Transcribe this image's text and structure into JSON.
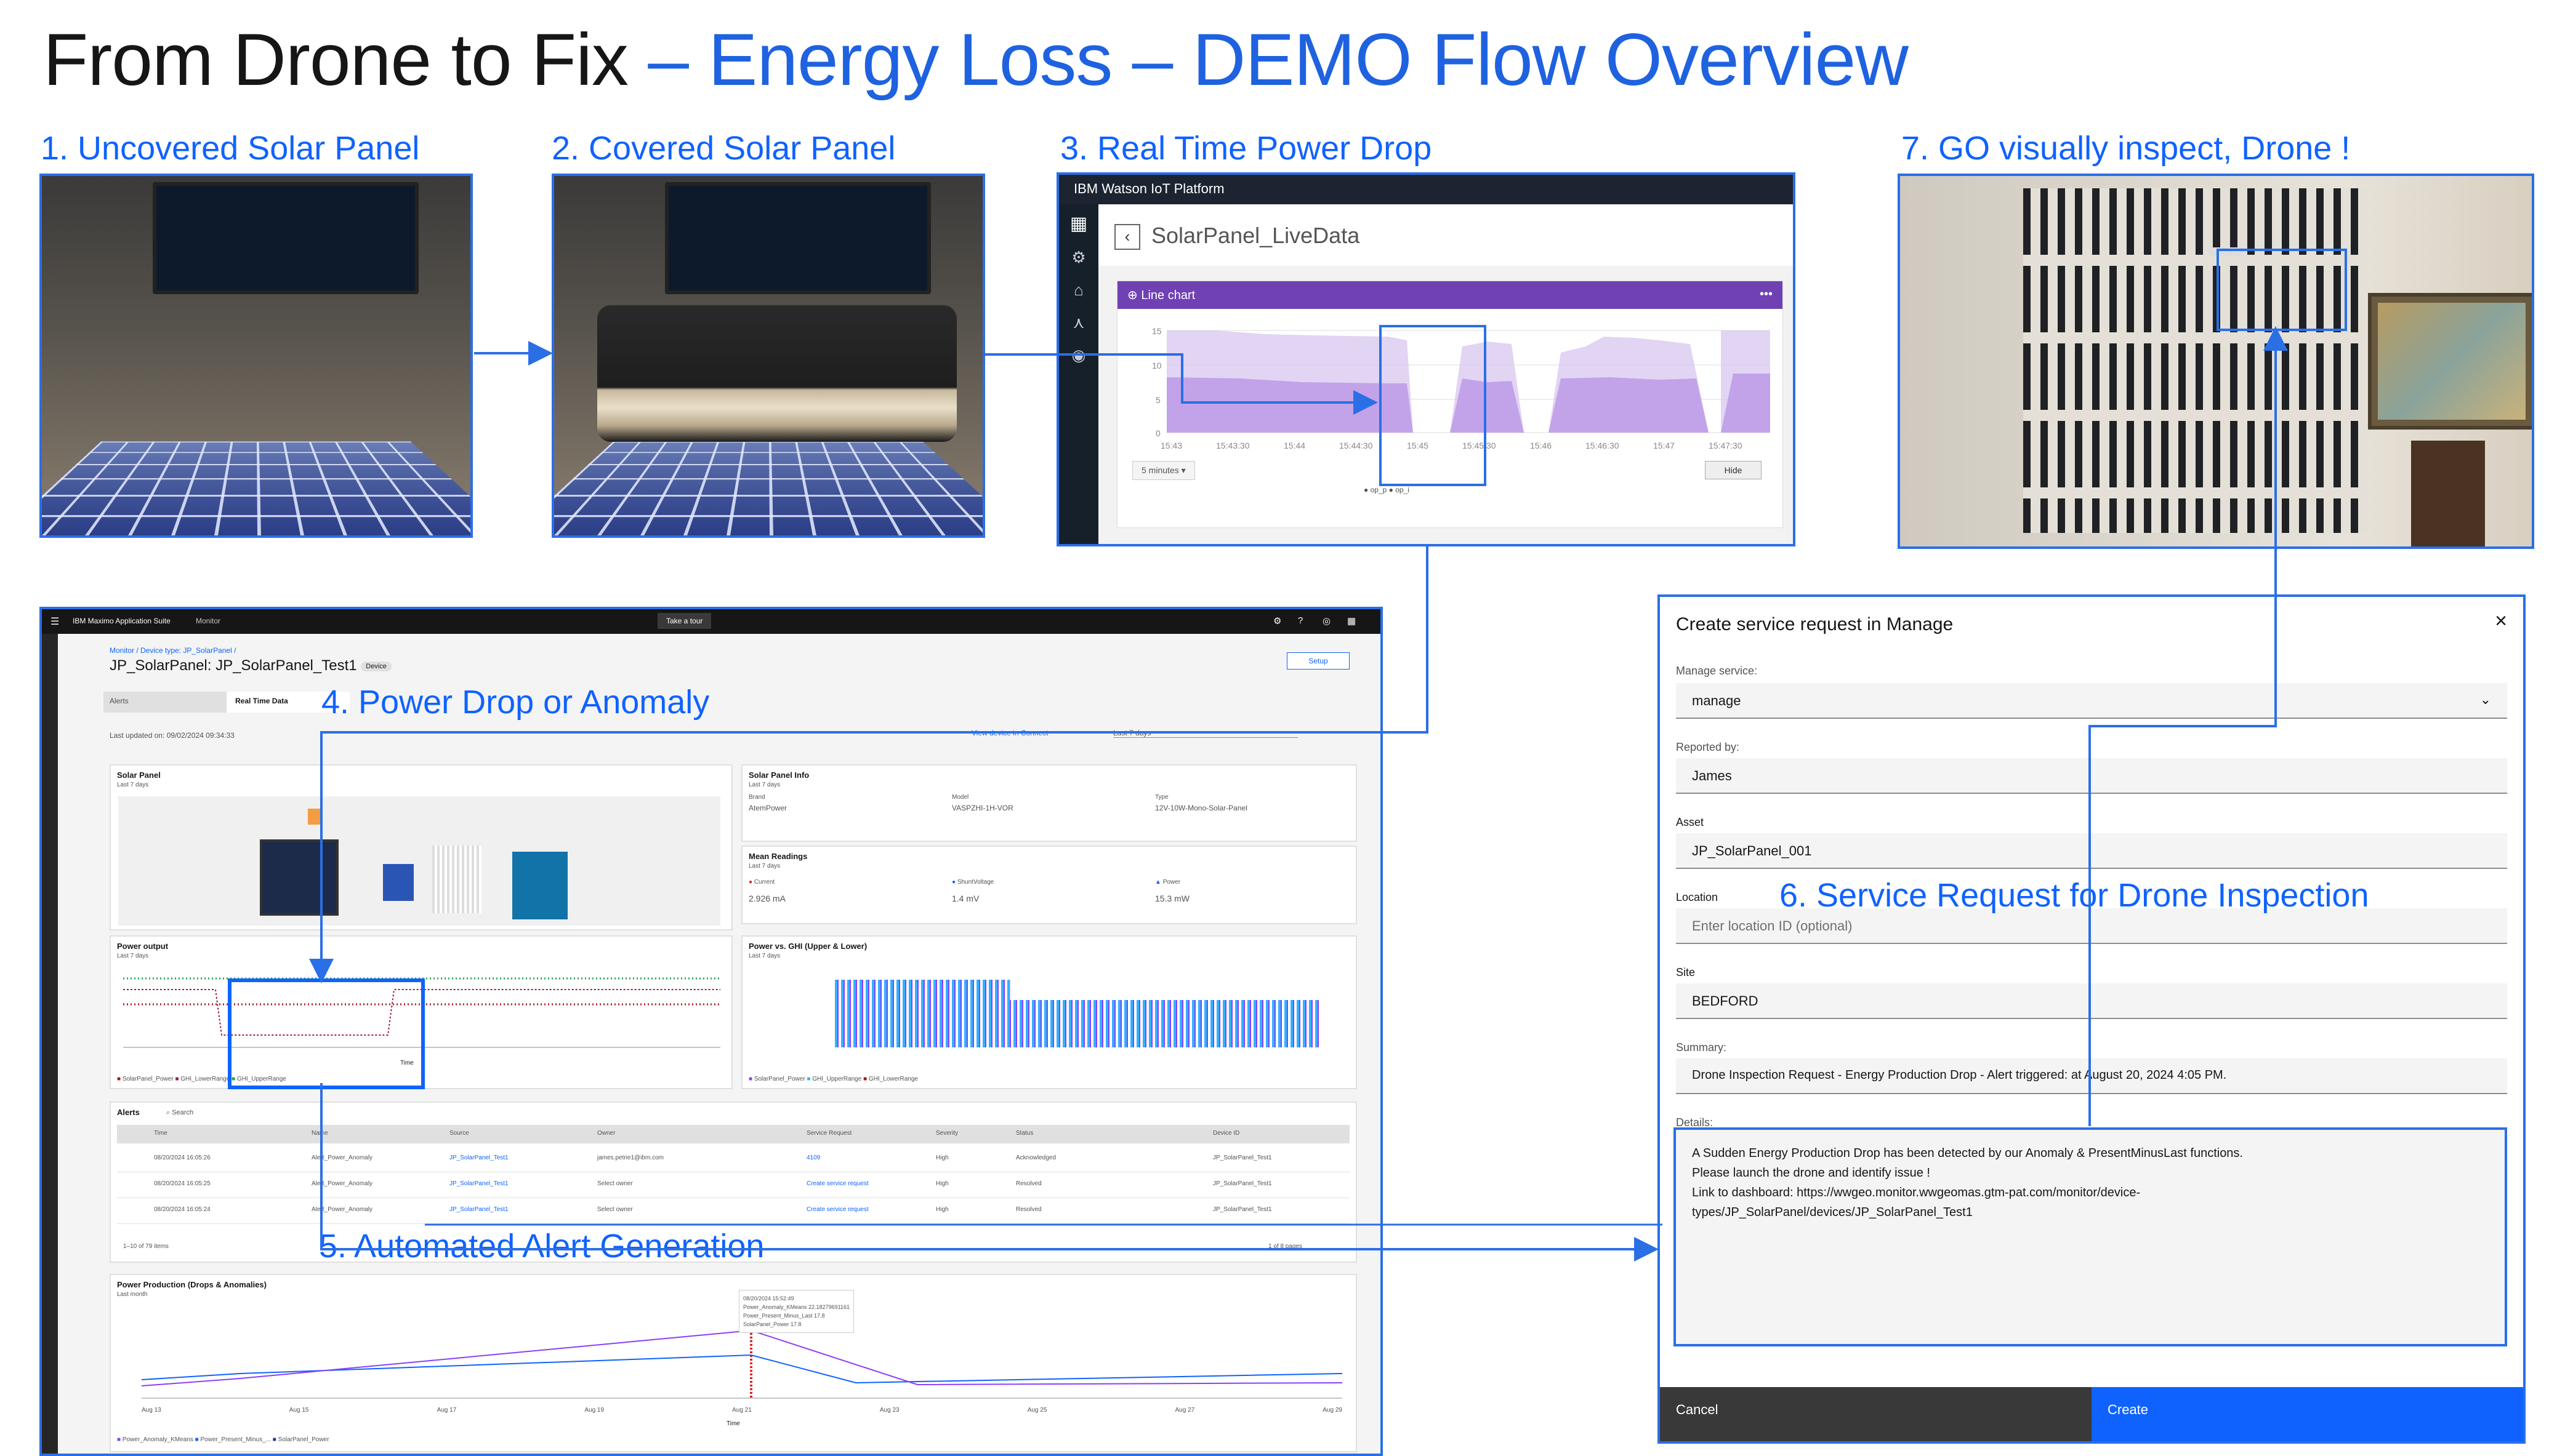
{
  "title": {
    "part1": "From Drone to Fix",
    "part2": "– Energy Loss – DEMO Flow Overview"
  },
  "steps": {
    "s1": "1. Uncovered Solar Panel",
    "s2": "2. Covered Solar Panel",
    "s3": "3. Real Time Power Drop",
    "s4": "4. Power Drop or Anomaly",
    "s5": "5. Automated Alert Generation",
    "s6": "6. Service Request for Drone Inspection",
    "s7": "7. GO visually inspect, Drone !"
  },
  "watson": {
    "platform": "IBM Watson IoT Platform",
    "page_title": "SolarPanel_LiveData",
    "chart_title": "Line chart",
    "menu": "•••",
    "range": "5 minutes",
    "button": "Hide",
    "x_ticks": [
      "15:43",
      "15:43:30",
      "15:44",
      "15:44:30",
      "15:45",
      "15:45:30",
      "15:46",
      "15:46:30",
      "15:47",
      "15:47:30"
    ],
    "y_ticks": [
      "15",
      "10",
      "5",
      "0"
    ],
    "legend": [
      "op_p",
      "op_i"
    ]
  },
  "maximo": {
    "suite": "IBM Maximo Application Suite",
    "app": "Monitor",
    "tour": "Take a tour",
    "breadcrumb": "Monitor  /  Device type: JP_SolarPanel  /",
    "device_title": "JP_SolarPanel: JP_SolarPanel_Test1",
    "device_tag": "Device",
    "setup": "Setup",
    "tabs": [
      "Alerts",
      "Real Time Data"
    ],
    "last_updated": "Last updated on:  09/02/2024 09:34:33",
    "view_device": "View device in Connect",
    "time_range": "Last 7 days",
    "solar_panel_card": {
      "title": "Solar Panel",
      "sub": "Last 7 days"
    },
    "info_card": {
      "title": "Solar Panel Info",
      "sub": "Last 7 days",
      "cols": [
        {
          "label": "Brand",
          "value": "AtemPower"
        },
        {
          "label": "Model",
          "value": "VASPZHI-1H-VOR"
        },
        {
          "label": "Type",
          "value": "12V-10W-Mono-Solar-Panel"
        }
      ]
    },
    "readings_card": {
      "title": "Mean Readings",
      "sub": "Last 7 days",
      "cols": [
        {
          "label": "Current",
          "value": "2.926 mA"
        },
        {
          "label": "ShuntVoltage",
          "value": "1.4 mV"
        },
        {
          "label": "Power",
          "value": "15.3 mW"
        }
      ]
    },
    "power_output": {
      "title": "Power output",
      "sub": "Last 7 days",
      "legend": [
        "SolarPanel_Power",
        "GHI_LowerRange",
        "GHI_UpperRange"
      ],
      "xlabel": "Time"
    },
    "power_ghi": {
      "title": "Power vs. GHI (Upper & Lower)",
      "sub": "Last 7 days",
      "legend": [
        "SolarPanel_Power",
        "GHI_UpperRange",
        "GHI_LowerRange"
      ]
    },
    "alerts": {
      "title": "Alerts",
      "search": "Search",
      "headers": [
        "Time",
        "Name",
        "Source",
        "Owner",
        "Service Request",
        "Severity",
        "Status",
        "Device ID"
      ],
      "rows": [
        [
          "08/20/2024 16:05:26",
          "Alert_Power_Anomaly",
          "JP_SolarPanel_Test1",
          "james.petrie1@ibm.com",
          "4109",
          "High",
          "Acknowledged",
          "JP_SolarPanel_Test1"
        ],
        [
          "08/20/2024 16:05:25",
          "Alert_Power_Anomaly",
          "JP_SolarPanel_Test1",
          "Select owner",
          "Create service request",
          "High",
          "Resolved",
          "JP_SolarPanel_Test1"
        ],
        [
          "08/20/2024 16:05:24",
          "Alert_Power_Anomaly",
          "JP_SolarPanel_Test1",
          "Select owner",
          "Create service request",
          "High",
          "Resolved",
          "JP_SolarPanel_Test1"
        ]
      ],
      "footer_left": "1–10 of 79 items",
      "footer_right": "1 of 8 pages"
    },
    "production": {
      "title": "Power Production (Drops & Anomalies)",
      "sub": "Last month",
      "tooltip": [
        "08/20/2024 15:52:49",
        "Power_Anomaly_KMeans  22.18279691161",
        "Power_Present_Minus_Last  17.8",
        "SolarPanel_Power  17.8"
      ],
      "x_ticks": [
        "Aug 13",
        "Aug 15",
        "Aug 17",
        "Aug 19",
        "Aug 21",
        "Aug 23",
        "Aug 25",
        "Aug 27",
        "Aug 29"
      ],
      "xlabel": "Time",
      "legend": [
        "Power_Anomaly_KMeans",
        "Power_Present_Minus_...",
        "SolarPanel_Power"
      ]
    }
  },
  "form": {
    "title": "Create service request in Manage",
    "close": "×",
    "fields": [
      {
        "label": "Manage service:",
        "value": "manage",
        "placeholder": false
      },
      {
        "label": "Reported by:",
        "value": "James",
        "placeholder": false
      },
      {
        "label": "Asset",
        "value": "JP_SolarPanel_001",
        "placeholder": false
      },
      {
        "label": "Location",
        "value": "Enter location ID (optional)",
        "placeholder": true
      },
      {
        "label": "Site",
        "value": "BEDFORD",
        "placeholder": false
      },
      {
        "label": "Summary:",
        "value": "Drone Inspection Request - Energy Production Drop - Alert triggered:  at August 20, 2024 4:05 PM.",
        "placeholder": false
      }
    ],
    "details_label": "Details:",
    "details_lines": [
      "A Sudden Energy Production Drop has been detected by our Anomaly & PresentMinusLast functions.",
      "Please launch the drone and identify issue !",
      "Link to dashboard: https://wwgeo.monitor.wwgeomas.gtm-pat.com/monitor/device-",
      "types/JP_SolarPanel/devices/JP_SolarPanel_Test1"
    ],
    "cancel": "Cancel",
    "create": "Create"
  },
  "colors": {
    "accent": "#0f62fe",
    "arrow": "#2a6fe6",
    "purple": "#6f41b3"
  }
}
